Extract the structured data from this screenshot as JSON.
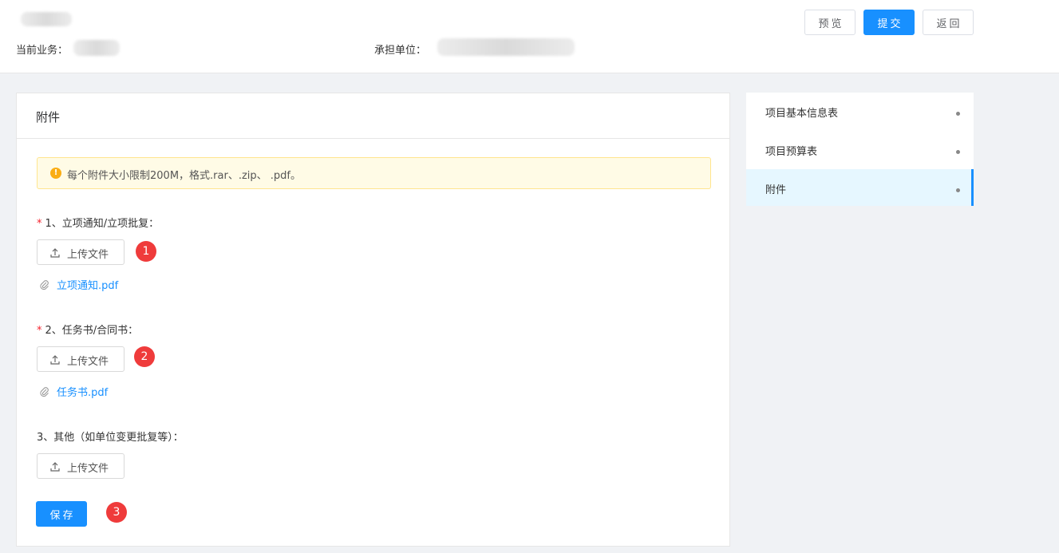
{
  "header": {
    "current_business_label": "当前业务：",
    "undertaking_unit_label": "承担单位：",
    "buttons": {
      "preview": "预览",
      "submit": "提交",
      "back": "返回"
    }
  },
  "card": {
    "title": "附件",
    "notice": "每个附件大小限制200M，格式.rar、.zip、 .pdf。",
    "sections": [
      {
        "required": true,
        "label": "1、立项通知/立项批复：",
        "upload_label": "上传文件",
        "file": "立项通知.pdf",
        "marker": "1"
      },
      {
        "required": true,
        "label": "2、任务书/合同书：",
        "upload_label": "上传文件",
        "file": "任务书.pdf",
        "marker": "2"
      },
      {
        "required": false,
        "label": "3、其他（如单位变更批复等）：",
        "upload_label": "上传文件"
      }
    ],
    "save_label": "保存",
    "save_marker": "3"
  },
  "sidenav": {
    "items": [
      {
        "label": "项目基本信息表",
        "active": false
      },
      {
        "label": "项目预算表",
        "active": false
      },
      {
        "label": "附件",
        "active": true
      }
    ]
  },
  "colors": {
    "primary": "#1890ff",
    "marker": "#ef3b3b",
    "notice_bg": "#fffbe6",
    "warning": "#faad14",
    "required": "#f5222d"
  }
}
